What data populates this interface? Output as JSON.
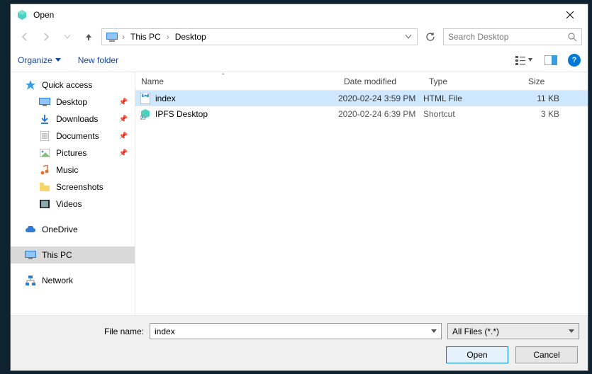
{
  "window": {
    "title": "Open"
  },
  "nav": {
    "crumbs": [
      "This PC",
      "Desktop"
    ],
    "search_placeholder": "Search Desktop"
  },
  "toolbar": {
    "organize": "Organize",
    "new_folder": "New folder"
  },
  "sidebar": {
    "quick_access": "Quick access",
    "quick_items": [
      {
        "label": "Desktop",
        "pinned": true
      },
      {
        "label": "Downloads",
        "pinned": true
      },
      {
        "label": "Documents",
        "pinned": true
      },
      {
        "label": "Pictures",
        "pinned": true
      },
      {
        "label": "Music",
        "pinned": false
      },
      {
        "label": "Screenshots",
        "pinned": false
      },
      {
        "label": "Videos",
        "pinned": false
      }
    ],
    "onedrive": "OneDrive",
    "this_pc": "This PC",
    "network": "Network"
  },
  "columns": {
    "name": "Name",
    "date": "Date modified",
    "type": "Type",
    "size": "Size"
  },
  "files": [
    {
      "name": "index",
      "date": "2020-02-24 3:59 PM",
      "type": "HTML File",
      "size": "11 KB",
      "selected": true,
      "icon": "html"
    },
    {
      "name": "IPFS Desktop",
      "date": "2020-02-24 6:39 PM",
      "type": "Shortcut",
      "size": "3 KB",
      "selected": false,
      "icon": "ipfs"
    }
  ],
  "footer": {
    "file_name_label": "File name:",
    "file_name_value": "index",
    "filter": "All Files (*.*)",
    "open": "Open",
    "cancel": "Cancel"
  }
}
